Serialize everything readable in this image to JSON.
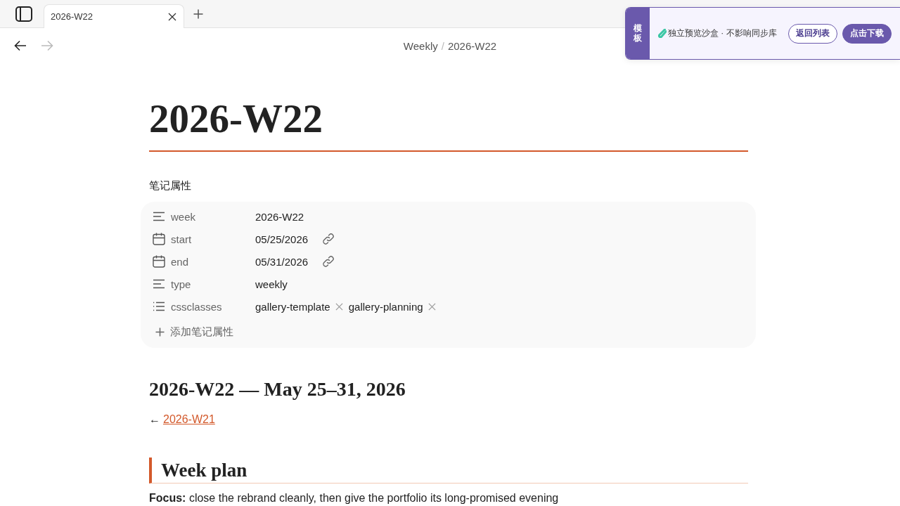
{
  "sidebar_toggle": {
    "on": false
  },
  "tabs": [
    {
      "title": "2026-W22",
      "selected": true
    }
  ],
  "nav_buttons": [
    {
      "kind": "back",
      "disabled": false
    },
    {
      "kind": "forward",
      "disabled": true
    }
  ],
  "breadcrumb": {
    "items": [
      "Weekly",
      "2026-W22"
    ],
    "separator": "/"
  },
  "banner": {
    "label": "模板",
    "message": "独立预览沙盒 · 不影响同步库",
    "buttons": [
      {
        "label": "返回列表",
        "kind": "outline"
      },
      {
        "label": "点击下载",
        "kind": "filled"
      }
    ]
  },
  "note": {
    "title": "2026-W22",
    "properties": {
      "heading": "笔记属性",
      "items": [
        {
          "kind": "text",
          "key": "week",
          "value": "2026-W22"
        },
        {
          "kind": "date",
          "key": "start",
          "value": "05/25/2026"
        },
        {
          "kind": "date",
          "key": "end",
          "value": "05/31/2026"
        },
        {
          "kind": "text",
          "key": "type",
          "value": "weekly"
        },
        {
          "kind": "list",
          "key": "cssclasses",
          "values": [
            "gallery-template",
            "gallery-planning"
          ]
        }
      ],
      "add_label": "添加笔记属性"
    },
    "body": [
      {
        "kind": "h2",
        "text": "2026-W22 — May 25–31, 2026"
      },
      {
        "kind": "backlink",
        "arrow": "←",
        "link": "2026-W21"
      },
      {
        "kind": "h3",
        "text": "Week plan"
      },
      {
        "kind": "paragraph",
        "text": "**Focus:** close the rebrand cleanly, then give the portfolio its long-promised evening"
      }
    ]
  }
}
